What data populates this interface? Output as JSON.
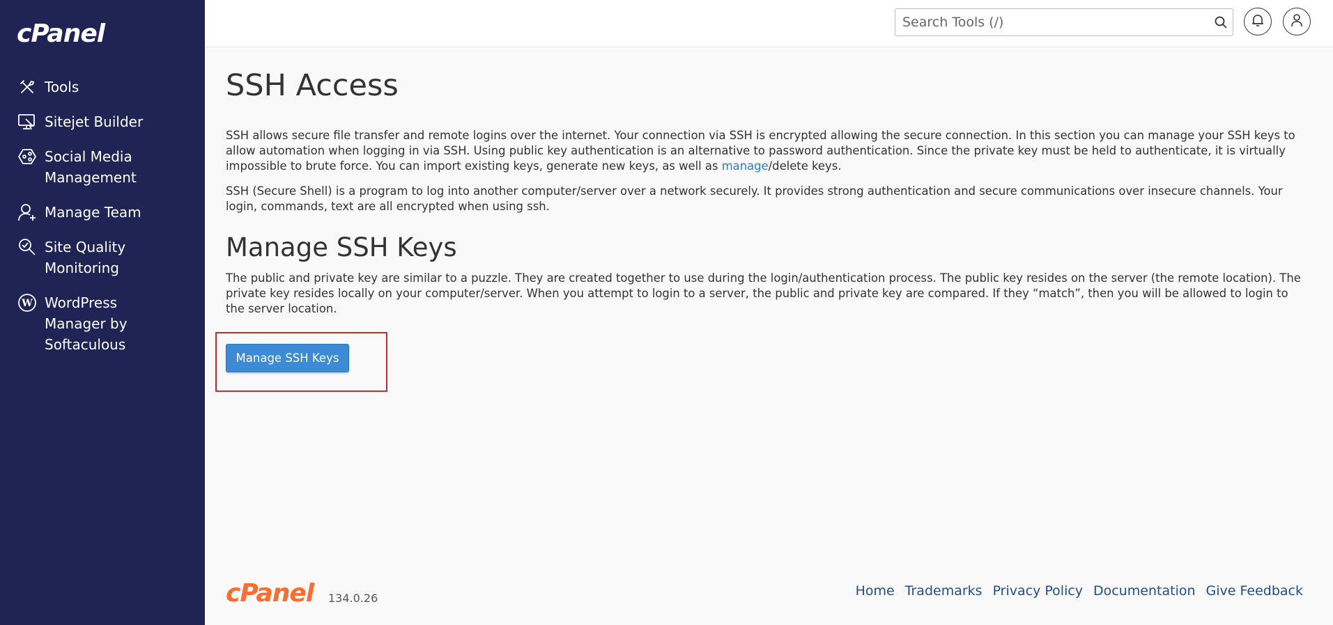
{
  "brand": {
    "logo_text": "cPanel"
  },
  "sidebar": {
    "items": [
      {
        "label": "Tools",
        "icon": "tools-icon"
      },
      {
        "label": "Sitejet Builder",
        "icon": "sitejet-icon"
      },
      {
        "label": "Social Media Management",
        "icon": "social-media-icon"
      },
      {
        "label": "Manage Team",
        "icon": "manage-team-icon"
      },
      {
        "label": "Site Quality Monitoring",
        "icon": "site-quality-icon"
      },
      {
        "label": "WordPress Manager by Softaculous",
        "icon": "wordpress-icon"
      }
    ]
  },
  "header": {
    "search_placeholder": "Search Tools (/)",
    "search_value": ""
  },
  "main": {
    "title": "SSH Access",
    "intro_before_link": "SSH allows secure file transfer and remote logins over the internet. Your connection via SSH is encrypted allowing the secure connection. In this section you can manage your SSH keys to allow automation when logging in via SSH. Using public key authentication is an alternative to password authentication. Since the private key must be held to authenticate, it is virtually impossible to brute force. You can import existing keys, generate new keys, as well as ",
    "intro_link": "manage",
    "intro_after_link": "/delete keys.",
    "intro_2": "SSH (Secure Shell) is a program to log into another computer/server over a network securely. It provides strong authentication and secure communications over insecure channels. Your login, commands, text are all encrypted when using ssh.",
    "section_title": "Manage SSH Keys",
    "section_text": "The public and private key are similar to a puzzle. They are created together to use during the login/authentication process. The public key resides on the server (the remote location). The private key resides locally on your computer/server. When you attempt to login to a server, the public and private key are compared. If they “match”, then you will be allowed to login to the server location.",
    "button_label": "Manage SSH Keys"
  },
  "footer": {
    "logo_text": "cPanel",
    "version": "134.0.26",
    "links": [
      "Home",
      "Trademarks",
      "Privacy Policy",
      "Documentation",
      "Give Feedback"
    ]
  },
  "colors": {
    "sidebar_bg": "#1f2454",
    "accent_orange": "#ff6c2c",
    "primary_button": "#3d8ad6",
    "link": "#1f4e8c",
    "highlight_border": "#d0282f"
  }
}
